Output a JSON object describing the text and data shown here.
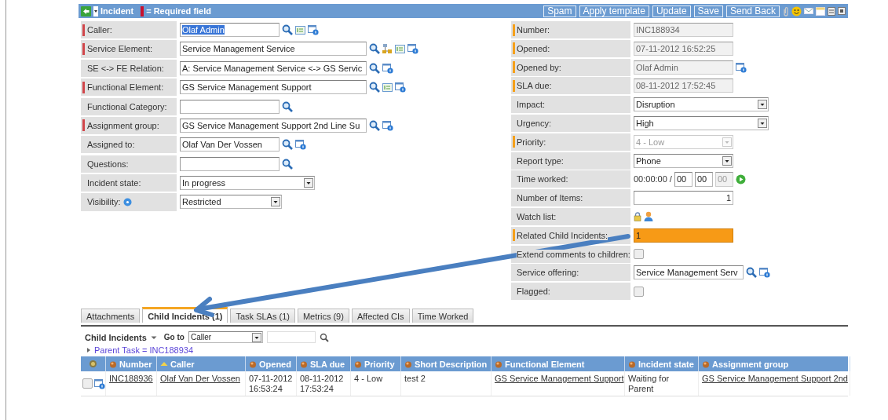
{
  "header": {
    "title": "Incident",
    "legend": "= Required field",
    "buttons": [
      "Spam",
      "Apply template",
      "Update",
      "Save",
      "Send Back"
    ]
  },
  "left_fields": [
    {
      "label": "Caller:",
      "required": true,
      "kind": "input",
      "value": "Olaf Admin",
      "text_selected": true
    },
    {
      "label": "Service Element:",
      "required": true,
      "kind": "input",
      "value": "Service Management Service",
      "text_selected": false
    },
    {
      "label": "SE <-> FE Relation:",
      "required": false,
      "kind": "input",
      "value": "A: Service Management Service <-> GS Servic",
      "text_selected": false
    },
    {
      "label": "Functional Element:",
      "required": true,
      "kind": "input",
      "value": "GS Service Management Support",
      "text_selected": false
    },
    {
      "label": "Functional Category:",
      "required": false,
      "kind": "input"
    },
    {
      "label": "Assignment group:",
      "required": true,
      "kind": "input",
      "value": "GS Service Management Support 2nd Line Su",
      "text_selected": false
    },
    {
      "label": "Assigned to:",
      "required": false,
      "kind": "input",
      "value": "Olaf Van Der Vossen",
      "text_selected": false
    },
    {
      "label": "Questions:",
      "required": false,
      "kind": "input"
    },
    {
      "label": "Incident state:",
      "required": false,
      "kind": "select",
      "value": "In progress",
      "disabled": false
    },
    {
      "label": "Visibility:",
      "required": false,
      "kind": "select",
      "value": "Restricted",
      "disabled": false
    }
  ],
  "right_fields": [
    {
      "label": "Number:",
      "flagged": true,
      "kind": "readonly",
      "value": "INC188934"
    },
    {
      "label": "Opened:",
      "flagged": true,
      "kind": "readonly",
      "value": "07-11-2012 16:52:25"
    },
    {
      "label": "Opened by:",
      "flagged": true,
      "kind": "readonly",
      "value": "Olaf Admin"
    },
    {
      "label": "SLA due:",
      "flagged": true,
      "kind": "readonly",
      "value": "08-11-2012 17:52:45"
    },
    {
      "label": "Impact:",
      "flagged": false,
      "kind": "select",
      "value": "Disruption",
      "disabled": false
    },
    {
      "label": "Urgency:",
      "flagged": false,
      "kind": "select",
      "value": "High",
      "disabled": false
    },
    {
      "label": "Priority:",
      "flagged": true,
      "kind": "select",
      "value": "4 - Low",
      "disabled": true
    },
    {
      "label": "Report type:",
      "flagged": false,
      "kind": "select",
      "value": "Phone",
      "disabled": false
    },
    {
      "label": "Time worked:",
      "flagged": false,
      "kind": "timer",
      "elapsed": "00:00:00 /",
      "hours": "00",
      "minutes": "00",
      "seconds": "00"
    },
    {
      "label": "Number of Items:",
      "flagged": false,
      "kind": "number",
      "value": "1"
    },
    {
      "label": "Watch list:",
      "flagged": false,
      "kind": "watchlist"
    },
    {
      "label": "Related Child Incidents:",
      "flagged": true,
      "kind": "input",
      "value": "1",
      "highlighted": true
    },
    {
      "label": "Extend comments to children:",
      "flagged": false,
      "kind": "checkbox",
      "checked": false
    },
    {
      "label": "Service offering:",
      "flagged": false,
      "kind": "input",
      "value": "Service Management Serv",
      "highlighted": false
    },
    {
      "label": "Flagged:",
      "flagged": false,
      "kind": "checkbox",
      "checked": false
    }
  ],
  "tabs": [
    {
      "label": "Attachments",
      "selected": false
    },
    {
      "label": "Child Incidents (1)",
      "selected": true
    },
    {
      "label": "Task SLAs (1)",
      "selected": false
    },
    {
      "label": "Metrics (9)",
      "selected": false
    },
    {
      "label": "Affected CIs",
      "selected": false
    },
    {
      "label": "Time Worked",
      "selected": false
    }
  ],
  "list_toolbar": {
    "title": "Child Incidents",
    "goto_label": "Go to",
    "goto_value": "Caller"
  },
  "breadcrumb": "Parent Task = INC188934",
  "table": {
    "columns": [
      {
        "label": "Number",
        "sorted": false,
        "link": true
      },
      {
        "label": "Caller",
        "sorted": true,
        "link": true
      },
      {
        "label": "Opened",
        "sorted": false,
        "link": false
      },
      {
        "label": "SLA due",
        "sorted": false,
        "link": false
      },
      {
        "label": "Priority",
        "sorted": false,
        "link": false
      },
      {
        "label": "Short Description",
        "sorted": false,
        "link": false
      },
      {
        "label": "Functional Element",
        "sorted": false,
        "link": true
      },
      {
        "label": "Incident state",
        "sorted": false,
        "link": false
      },
      {
        "label": "Assignment group",
        "sorted": false,
        "link": true
      }
    ],
    "rows": [
      {
        "checked": false,
        "cells": [
          "INC188936",
          "Olaf Van Der Vossen",
          "07-11-2012 16:53:24",
          "08-11-2012 17:53:24",
          "4 - Low",
          "test 2",
          "GS Service Management Support",
          "Waiting for Parent",
          "GS Service Management Support 2nd"
        ]
      }
    ]
  }
}
